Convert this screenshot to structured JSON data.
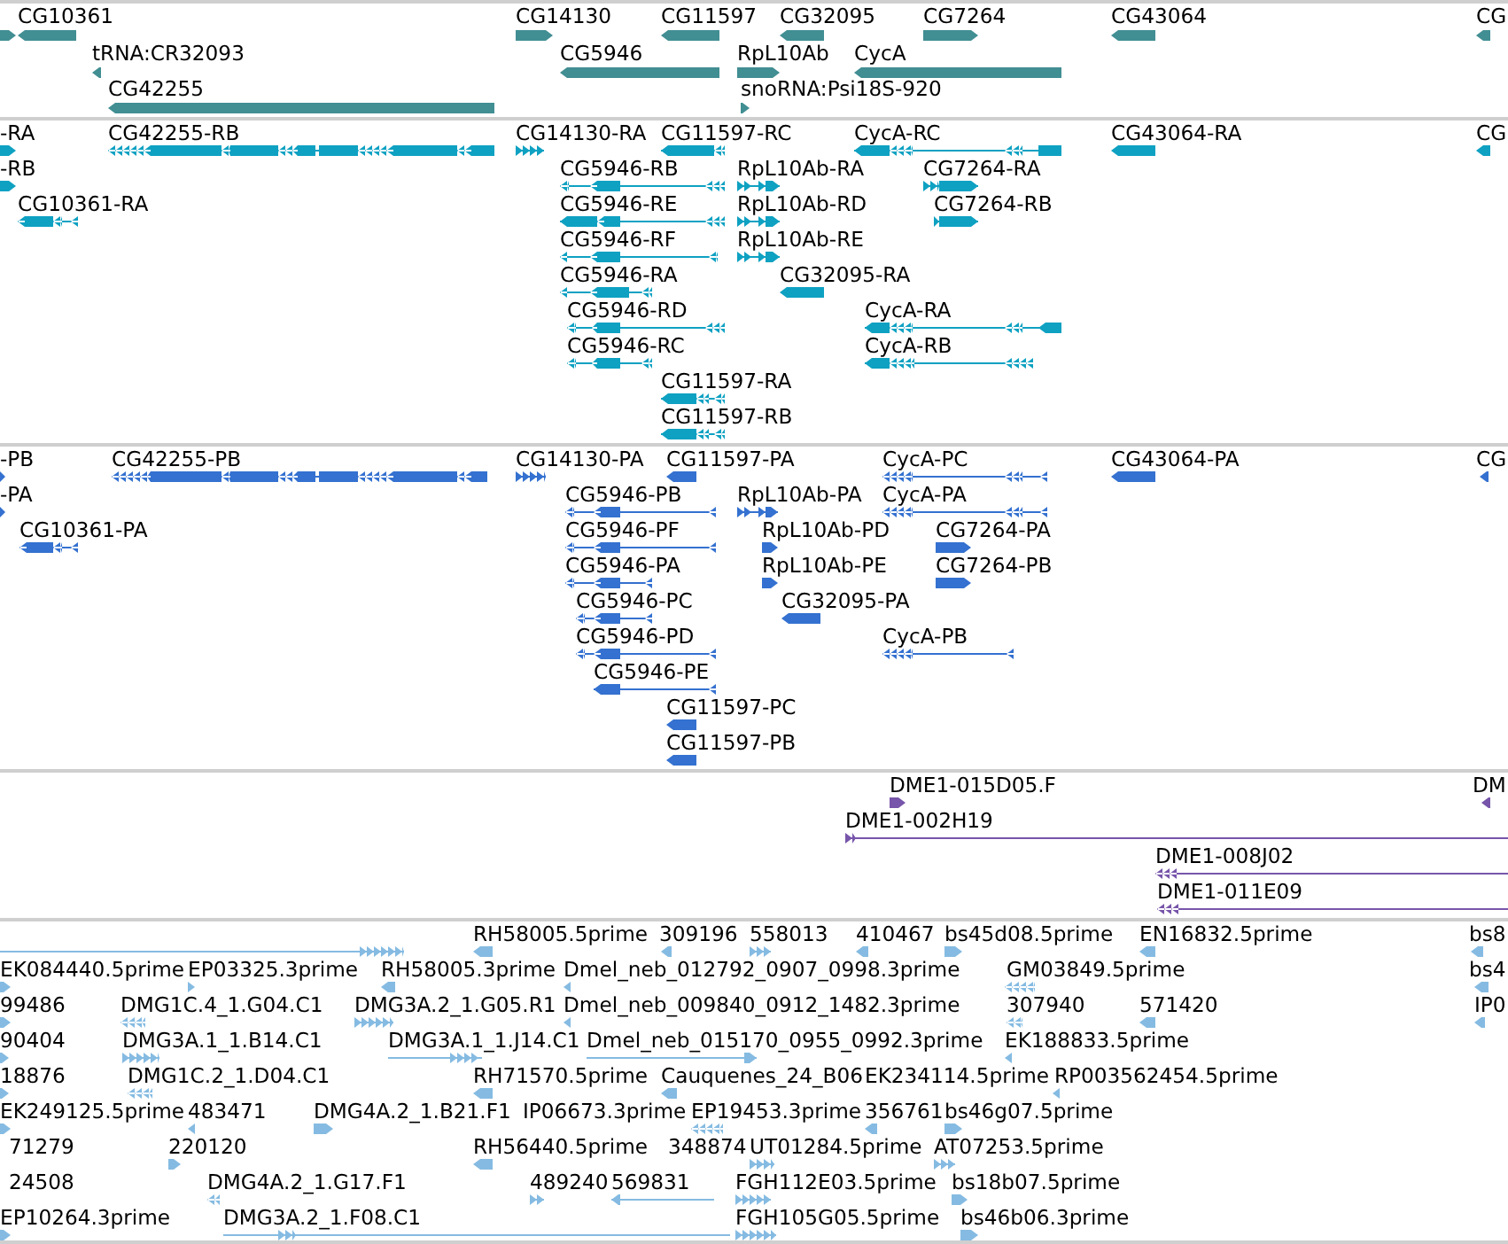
{
  "tracks": [
    {
      "color": "#418e93",
      "features": [
        {
          "reverse": false
        },
        {
          "label": "CG10361",
          "reverse": true
        },
        {
          "label": "CG14130",
          "reverse": false
        },
        {
          "label": "CG11597",
          "reverse": true
        },
        {
          "label": "CG32095",
          "reverse": true
        },
        {
          "label": "CG7264",
          "reverse": false
        },
        {
          "label": "CG43064",
          "reverse": true
        },
        {
          "label": "CG",
          "reverse": true
        },
        {
          "label": "tRNA:CR32093",
          "reverse": true
        },
        {
          "label": "CG5946",
          "reverse": true
        },
        {
          "label": "RpL10Ab",
          "reverse": false
        },
        {
          "label": "CycA",
          "reverse": true
        },
        {
          "label": "CG42255",
          "reverse": true
        },
        {
          "label": "snoRNA:Psi18S-920",
          "reverse": false
        }
      ]
    },
    {
      "color": "#0ea1c2",
      "features": [
        {
          "label": "-RA",
          "reverse": false
        },
        {
          "label": "CG42255-RB",
          "reverse": true
        },
        {
          "label": "CG14130-RA",
          "reverse": false
        },
        {
          "label": "CG11597-RC",
          "reverse": true
        },
        {
          "label": "CycA-RC",
          "reverse": true
        },
        {
          "label": "CG43064-RA",
          "reverse": true
        },
        {
          "label": "CG",
          "reverse": true
        },
        {
          "label": "-RB",
          "reverse": false
        },
        {
          "label": "CG5946-RB",
          "reverse": true
        },
        {
          "label": "RpL10Ab-RA",
          "reverse": false
        },
        {
          "label": "CG7264-RA",
          "reverse": false
        },
        {
          "label": "CG10361-RA",
          "reverse": true
        },
        {
          "label": "CG5946-RE",
          "reverse": true
        },
        {
          "label": "RpL10Ab-RD",
          "reverse": false
        },
        {
          "label": "CG7264-RB",
          "reverse": false
        },
        {
          "label": "CG5946-RF",
          "reverse": true
        },
        {
          "label": "RpL10Ab-RE",
          "reverse": false
        },
        {
          "label": "CG5946-RA",
          "reverse": true
        },
        {
          "label": "CG32095-RA",
          "reverse": true
        },
        {
          "label": "CG5946-RD",
          "reverse": true
        },
        {
          "label": "CycA-RA",
          "reverse": true
        },
        {
          "label": "CG5946-RC",
          "reverse": true
        },
        {
          "label": "CycA-RB",
          "reverse": true
        },
        {
          "label": "CG11597-RA",
          "reverse": true
        },
        {
          "label": "CG11597-RB",
          "reverse": true
        }
      ]
    },
    {
      "color": "#3471d0",
      "features": [
        {
          "label": "-PB",
          "reverse": false
        },
        {
          "label": "CG42255-PB",
          "reverse": true
        },
        {
          "label": "CG14130-PA",
          "reverse": false
        },
        {
          "label": "CG11597-PA",
          "reverse": true
        },
        {
          "label": "CycA-PC",
          "reverse": true
        },
        {
          "label": "CG43064-PA",
          "reverse": true
        },
        {
          "label": "CG",
          "reverse": true
        },
        {
          "label": "-PA",
          "reverse": false
        },
        {
          "label": "CG5946-PB",
          "reverse": true
        },
        {
          "label": "RpL10Ab-PA",
          "reverse": false
        },
        {
          "label": "CycA-PA",
          "reverse": true
        },
        {
          "label": "CG10361-PA",
          "reverse": true
        },
        {
          "label": "CG5946-PF",
          "reverse": true
        },
        {
          "label": "RpL10Ab-PD",
          "reverse": false
        },
        {
          "label": "CG7264-PA",
          "reverse": false
        },
        {
          "label": "CG5946-PA",
          "reverse": true
        },
        {
          "label": "RpL10Ab-PE",
          "reverse": false
        },
        {
          "label": "CG7264-PB",
          "reverse": false
        },
        {
          "label": "CG5946-PC",
          "reverse": true
        },
        {
          "label": "CG32095-PA",
          "reverse": true
        },
        {
          "label": "CG5946-PD",
          "reverse": true
        },
        {
          "label": "CycA-PB",
          "reverse": true
        },
        {
          "label": "CG5946-PE",
          "reverse": true
        },
        {
          "label": "CG11597-PC",
          "reverse": true
        },
        {
          "label": "CG11597-PB",
          "reverse": true
        }
      ]
    },
    {
      "color": "#7755aa",
      "features": [
        {
          "label": "DME1-015D05.F",
          "reverse": false
        },
        {
          "label": "DM",
          "reverse": true
        },
        {
          "label": "DME1-002H19",
          "reverse": false
        },
        {
          "label": "DME1-008J02",
          "reverse": true
        },
        {
          "label": "DME1-011E09",
          "reverse": true
        }
      ]
    },
    {
      "color": "#85bbe2",
      "features": [
        {
          "reverse": false
        },
        {
          "label": "RH58005.5prime",
          "reverse": true
        },
        {
          "label": "309196",
          "reverse": true
        },
        {
          "label": "558013",
          "reverse": false
        },
        {
          "label": "410467",
          "reverse": true
        },
        {
          "label": "bs45d08.5prime",
          "reverse": false
        },
        {
          "label": "EN16832.5prime",
          "reverse": true
        },
        {
          "label": "bs8",
          "reverse": true
        },
        {
          "label": "EK084440.5prime",
          "reverse": false
        },
        {
          "label": "EP03325.3prime",
          "reverse": false
        },
        {
          "label": "RH58005.3prime",
          "reverse": true
        },
        {
          "label": "Dmel_neb_012792_0907_0998.3prime",
          "reverse": true
        },
        {
          "label": "GM03849.5prime",
          "reverse": true
        },
        {
          "label": "bs4",
          "reverse": true
        },
        {
          "label": "99486",
          "reverse": false
        },
        {
          "label": "DMG1C.4_1.G04.C1",
          "reverse": true
        },
        {
          "label": "DMG3A.2_1.G05.R1",
          "reverse": false
        },
        {
          "label": "Dmel_neb_009840_0912_1482.3prime",
          "reverse": true
        },
        {
          "label": "307940",
          "reverse": true
        },
        {
          "label": "571420",
          "reverse": true
        },
        {
          "label": "IP0",
          "reverse": true
        },
        {
          "label": "90404",
          "reverse": false
        },
        {
          "label": "DMG3A.1_1.B14.C1",
          "reverse": false
        },
        {
          "label": "DMG3A.1_1.J14.C1",
          "reverse": false
        },
        {
          "label": "Dmel_neb_015170_0955_0992.3prime",
          "reverse": false
        },
        {
          "label": "EK188833.5prime",
          "reverse": true
        },
        {
          "label": "18876",
          "reverse": false
        },
        {
          "label": "DMG1C.2_1.D04.C1",
          "reverse": true
        },
        {
          "label": "RH71570.5prime",
          "reverse": true
        },
        {
          "label": "Cauquenes_24_B06",
          "reverse": true
        },
        {
          "label": "EK234114.5prime"
        },
        {
          "label": "RP003562454.5prime",
          "reverse": true
        },
        {
          "label": "EK249125.5prime",
          "reverse": false
        },
        {
          "label": "483471",
          "reverse": true
        },
        {
          "label": "DMG4A.2_1.B21.F1",
          "reverse": false
        },
        {
          "label": "IP06673.3prime"
        },
        {
          "label": "EP19453.3prime",
          "reverse": true
        },
        {
          "label": "356761",
          "reverse": true
        },
        {
          "label": "bs46g07.5prime",
          "reverse": false
        },
        {
          "label": "71279"
        },
        {
          "label": "220120",
          "reverse": false
        },
        {
          "label": "RH56440.5prime",
          "reverse": true
        },
        {
          "label": "348874"
        },
        {
          "label": "UT01284.5prime",
          "reverse": false
        },
        {
          "label": "AT07253.5prime",
          "reverse": false
        },
        {
          "label": "24508"
        },
        {
          "label": "DMG4A.2_1.G17.F1",
          "reverse": true
        },
        {
          "label": "489240",
          "reverse": false
        },
        {
          "label": "569831",
          "reverse": true
        },
        {
          "label": "FGH112E03.5prime",
          "reverse": false
        },
        {
          "label": "bs18b07.5prime",
          "reverse": false
        },
        {
          "label": "EP10264.3prime",
          "reverse": false
        },
        {
          "label": "DMG3A.2_1.F08.C1",
          "reverse": false
        },
        {
          "label": "FGH105G05.5prime",
          "reverse": false
        },
        {
          "label": "bs46b06.3prime",
          "reverse": false
        }
      ]
    }
  ]
}
